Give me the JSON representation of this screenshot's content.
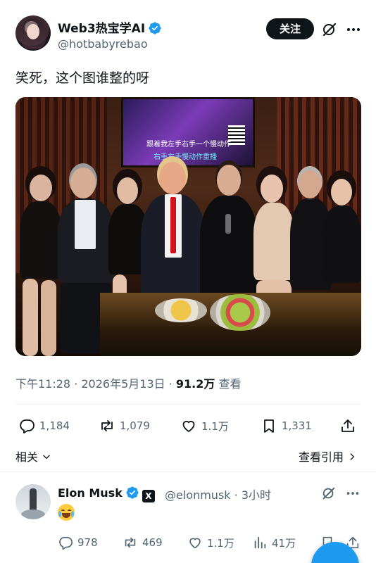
{
  "author": {
    "name": "Web3热宝学AI",
    "handle": "@hotbabyrebao",
    "verified": true
  },
  "header": {
    "follow_label": "关注"
  },
  "tweet": {
    "text": "笑死，这个图谁整的呀"
  },
  "photo": {
    "subtitle_line1": "跟着我左手右手一个慢动作",
    "subtitle_line2": "右手左手慢动作重播"
  },
  "meta": {
    "time": "下午11:28 · 2026年5月13日 · ",
    "views": "91.2万",
    "views_label": " 查看"
  },
  "actions": {
    "replies": "1,184",
    "retweets": "1,079",
    "likes": "1.1万",
    "bookmarks": "1,331"
  },
  "related": {
    "label": "相关",
    "quotes_label": "查看引用"
  },
  "reply": {
    "name": "Elon Musk",
    "handle": "@elonmusk",
    "time": "3小时",
    "replies": "978",
    "retweets": "469",
    "likes": "1.1万",
    "views": "41万"
  },
  "colors": {
    "accent": "#1d9bf0",
    "text": "#0f1419",
    "secondary": "#536471"
  }
}
